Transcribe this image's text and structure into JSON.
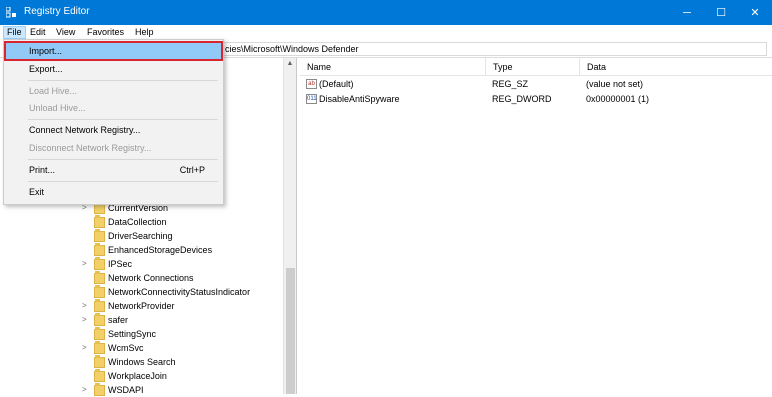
{
  "window": {
    "title": "Registry Editor",
    "icon": "registry-editor-icon",
    "controls": {
      "minimize": "─",
      "maximize": "☐",
      "close": "✕"
    }
  },
  "menubar": {
    "items": [
      {
        "label": "File",
        "active": true
      },
      {
        "label": "Edit"
      },
      {
        "label": "View"
      },
      {
        "label": "Favorites"
      },
      {
        "label": "Help"
      }
    ]
  },
  "address": {
    "visible_text": "cies\\Microsoft\\Windows Defender"
  },
  "file_menu": {
    "items": [
      {
        "label": "Import...",
        "enabled": true,
        "highlighted": true
      },
      {
        "label": "Export...",
        "enabled": true
      },
      {
        "label": "Load Hive...",
        "enabled": false
      },
      {
        "label": "Unload Hive...",
        "enabled": false
      },
      {
        "label": "Connect Network Registry...",
        "enabled": true
      },
      {
        "label": "Disconnect Network Registry...",
        "enabled": false
      },
      {
        "label": "Print...",
        "enabled": true,
        "shortcut": "Ctrl+P"
      },
      {
        "label": "Exit",
        "enabled": true
      }
    ],
    "annotation_color": "#d9252f"
  },
  "tree": {
    "items": [
      {
        "label": "CurrentVersion",
        "expandable": true
      },
      {
        "label": "DataCollection",
        "expandable": false
      },
      {
        "label": "DriverSearching",
        "expandable": false
      },
      {
        "label": "EnhancedStorageDevices",
        "expandable": false
      },
      {
        "label": "IPSec",
        "expandable": true
      },
      {
        "label": "Network Connections",
        "expandable": false
      },
      {
        "label": "NetworkConnectivityStatusIndicator",
        "expandable": false
      },
      {
        "label": "NetworkProvider",
        "expandable": true
      },
      {
        "label": "safer",
        "expandable": true
      },
      {
        "label": "SettingSync",
        "expandable": false
      },
      {
        "label": "WcmSvc",
        "expandable": true
      },
      {
        "label": "Windows Search",
        "expandable": false
      },
      {
        "label": "WorkplaceJoin",
        "expandable": false
      },
      {
        "label": "WSDAPI",
        "expandable": true
      }
    ]
  },
  "values": {
    "columns": [
      "Name",
      "Type",
      "Data"
    ],
    "rows": [
      {
        "icon": "string-value-icon",
        "icon_glyph": "ab",
        "name": "(Default)",
        "type": "REG_SZ",
        "data": "(value not set)"
      },
      {
        "icon": "binary-value-icon",
        "icon_glyph": "011",
        "name": "DisableAntiSpyware",
        "type": "REG_DWORD",
        "data": "0x00000001 (1)"
      }
    ]
  },
  "colors": {
    "titlebar": "#0078d7",
    "menu_highlight": "#91c9f7",
    "folder": "#f2d067"
  }
}
